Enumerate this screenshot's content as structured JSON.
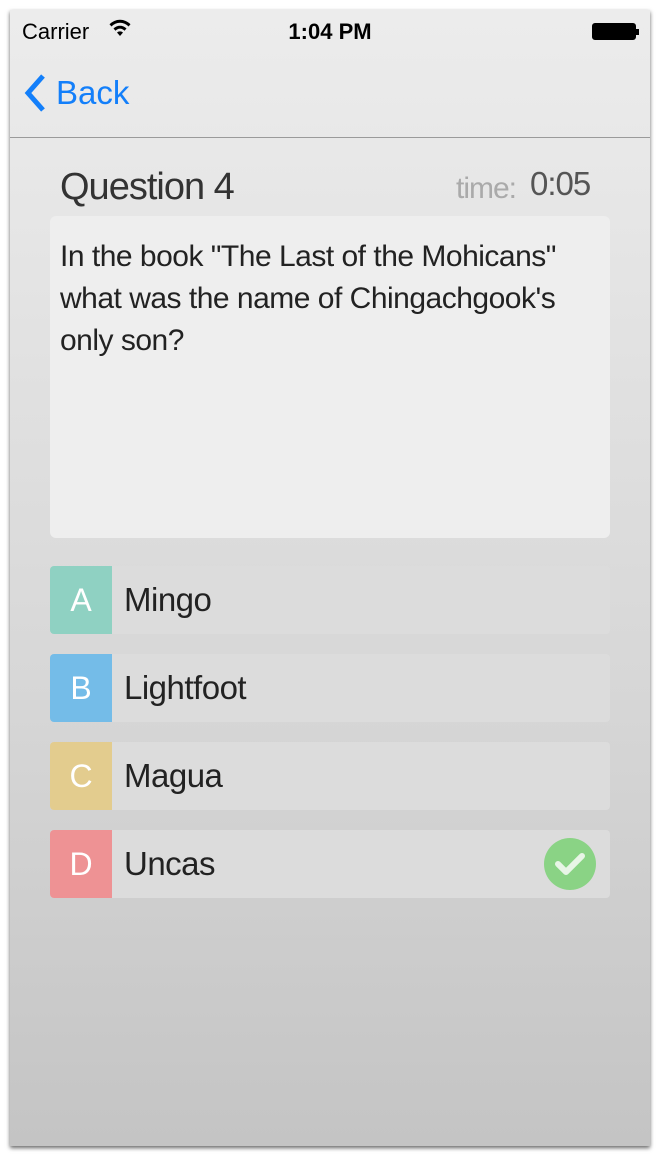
{
  "status": {
    "carrier": "Carrier",
    "time": "1:04 PM"
  },
  "nav": {
    "back_label": "Back"
  },
  "quiz": {
    "title": "Question 4",
    "time_label": "time:",
    "time_value": "0:05",
    "question": "In the book \"The Last of the Mohicans\" what was the name of Chingachgook's only son?",
    "answers": [
      {
        "letter": "A",
        "text": "Mingo",
        "color": "#8fd1c2"
      },
      {
        "letter": "B",
        "text": "Lightfoot",
        "color": "#74bce8"
      },
      {
        "letter": "C",
        "text": "Magua",
        "color": "#e3cc8e"
      },
      {
        "letter": "D",
        "text": "Uncas",
        "color": "#ee9294",
        "correct": true
      }
    ]
  },
  "colors": {
    "accent": "#137ffa",
    "correct": "#8ad385"
  }
}
